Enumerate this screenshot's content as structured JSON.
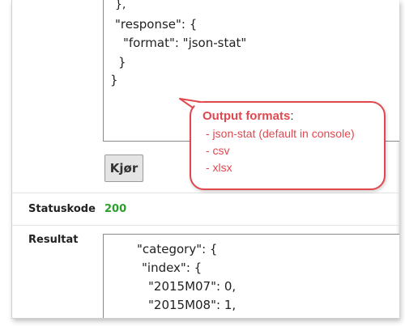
{
  "request": {
    "lines": [
      "},",
      "\"response\": {",
      "\"format\": \"json-stat\"",
      "}",
      "}"
    ]
  },
  "run_button": {
    "label": "Kjør"
  },
  "status": {
    "label": "Statuskode",
    "value": "200",
    "value_color": "#2e9e2e"
  },
  "result": {
    "label": "Resultat",
    "lines": [
      "\"category\": {",
      "\"index\": {",
      "\"2015M07\": 0,",
      "\"2015M08\": 1,"
    ]
  },
  "callout": {
    "title": "Output formats",
    "title_suffix": ":",
    "items": [
      "- json-stat (default in console)",
      "- csv",
      "- xlsx"
    ],
    "accent_color": "#e0484e"
  }
}
